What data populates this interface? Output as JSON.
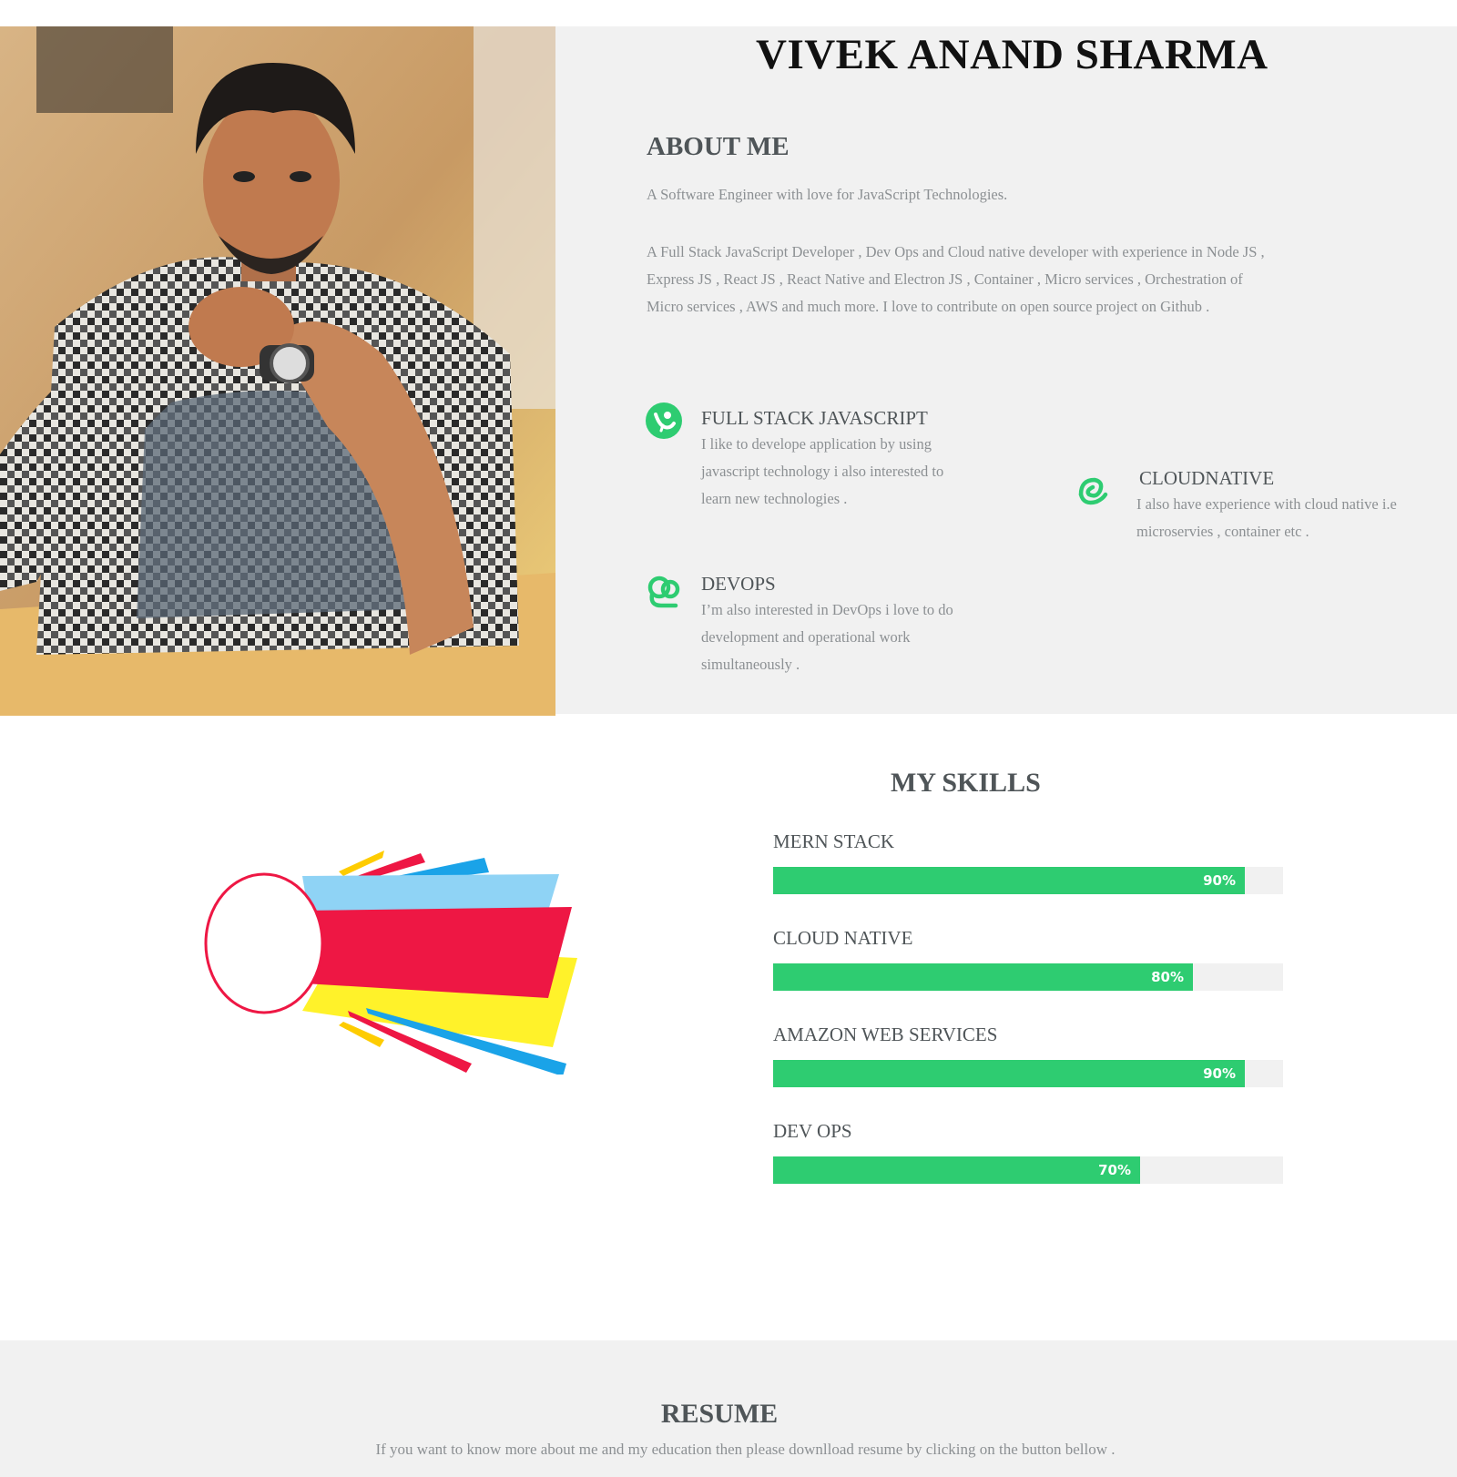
{
  "profile": {
    "name": "VIVEK ANAND SHARMA",
    "photo_alt": "profile-photo"
  },
  "about": {
    "title": "ABOUT ME",
    "tagline": "A Software Engineer with love for JavaScript Technologies.",
    "description": "A Full Stack JavaScript Developer , Dev Ops and Cloud native developer with experience in Node JS , Express JS , React JS , React Native and Electron JS , Container , Micro services , Orchestration of Micro services , AWS and much more. I love to contribute on open source project on Github .",
    "features": [
      {
        "title": "FULL STACK JAVASCRIPT",
        "text": "I like to develope application by using javascript technology i also interested to learn new technologies .",
        "icon": "rocket-icon"
      },
      {
        "title": "CLOUDNATIVE",
        "text": "I also have experience with cloud native i.e microservies , container etc .",
        "icon": "cloud-swirl-icon"
      },
      {
        "title": "DEVOPS",
        "text": "I’m also interested in DevOps i love to do development and operational work simultaneously .",
        "icon": "devops-icon"
      }
    ]
  },
  "skills": {
    "title": "MY SKILLS",
    "items": [
      {
        "label": "MERN STACK",
        "value": 90,
        "value_label": "90%"
      },
      {
        "label": "CLOUD NATIVE",
        "value": 80,
        "value_label": "80%"
      },
      {
        "label": "AMAZON WEB SERVICES",
        "value": 90,
        "value_label": "90%"
      },
      {
        "label": "DEV OPS",
        "value": 70,
        "value_label": "70%"
      }
    ]
  },
  "resume": {
    "title": "RESUME",
    "text": "If you want to know more about me and my education then please downlload resume by clicking on the button bellow ."
  },
  "colors": {
    "accent": "#2ecc71",
    "section_bg": "#f1f1f1",
    "heading": "#4f5558",
    "body_text": "#8c9093"
  }
}
